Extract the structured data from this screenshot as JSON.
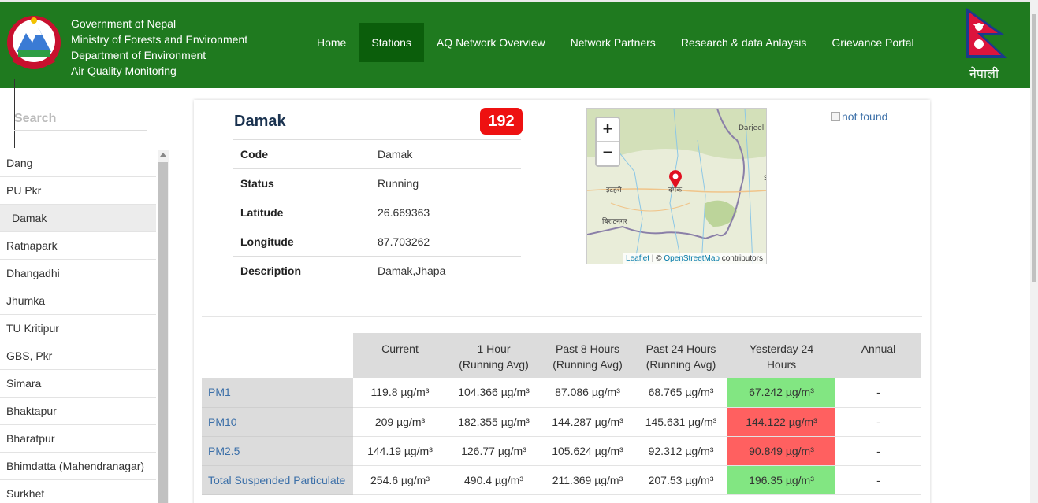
{
  "header": {
    "gov_lines": [
      "Government of Nepal",
      "Ministry of Forests and Environment",
      "Department of Environment",
      "Air Quality Monitoring"
    ],
    "nav": [
      "Home",
      "Stations",
      "AQ Network Overview",
      "Network Partners",
      "Research & data Anlaysis",
      "Grievance Portal"
    ],
    "active_nav": "Stations",
    "language_toggle": "नेपाली",
    "colors": {
      "header_bg": "#1f7a1f",
      "active_nav_bg": "#0b5e0b"
    }
  },
  "sidebar": {
    "search_placeholder": "Search",
    "stations": [
      "Dang",
      "PU Pkr",
      "Damak",
      "Ratnapark",
      "Dhangadhi",
      "Jhumka",
      "TU Kritipur",
      "GBS, Pkr",
      "Simara",
      "Bhaktapur",
      "Bharatpur",
      "Bhimdatta (Mahendranagar)",
      "Surkhet"
    ],
    "selected": "Damak"
  },
  "station": {
    "name": "Damak",
    "aqi": "192",
    "aqi_color": "#ee1111",
    "fields": [
      {
        "label": "Code",
        "value": "Damak"
      },
      {
        "label": "Status",
        "value": "Running"
      },
      {
        "label": "Latitude",
        "value": "26.669363"
      },
      {
        "label": "Longitude",
        "value": "87.703262"
      },
      {
        "label": "Description",
        "value": "Damak,Jhapa"
      }
    ]
  },
  "map": {
    "zoom_in": "+",
    "zoom_out": "−",
    "labels": {
      "darjeeling": "Darjeeli",
      "itahari": "इटहरी",
      "damak": "दमक",
      "biratnagar": "बिराटनगर",
      "s": "S"
    },
    "attribution": {
      "leaflet": "Leaflet",
      "sep": " | © ",
      "osm": "OpenStreetMap",
      "suffix": " contributors"
    }
  },
  "broken_image_alt": "not found",
  "pollutants": {
    "headers": [
      [
        "Current"
      ],
      [
        "1 Hour",
        "(Running Avg)"
      ],
      [
        "Past 8 Hours",
        "(Running Avg)"
      ],
      [
        "Past 24 Hours",
        "(Running Avg)"
      ],
      [
        "Yesterday 24",
        "Hours"
      ],
      [
        "Annual"
      ]
    ],
    "rows": [
      {
        "name": "PM1",
        "current": "119.8 µg/m³",
        "h1": "104.366 µg/m³",
        "h8": "87.086 µg/m³",
        "h24": "68.765 µg/m³",
        "yesterday": "67.242 µg/m³",
        "yesterday_status": "good",
        "annual": "-"
      },
      {
        "name": "PM10",
        "current": "209 µg/m³",
        "h1": "182.355 µg/m³",
        "h8": "144.287 µg/m³",
        "h24": "145.631 µg/m³",
        "yesterday": "144.122 µg/m³",
        "yesterday_status": "bad",
        "annual": "-"
      },
      {
        "name": "PM2.5",
        "current": "144.19 µg/m³",
        "h1": "126.77 µg/m³",
        "h8": "105.624 µg/m³",
        "h24": "92.312 µg/m³",
        "yesterday": "90.849 µg/m³",
        "yesterday_status": "bad",
        "annual": "-"
      },
      {
        "name": "Total Suspended Particulate",
        "current": "254.6 µg/m³",
        "h1": "490.4 µg/m³",
        "h8": "211.369 µg/m³",
        "h24": "207.53 µg/m³",
        "yesterday": "196.35 µg/m³",
        "yesterday_status": "good",
        "annual": "-"
      }
    ],
    "colors": {
      "good": "#82e682",
      "bad": "#ff6060"
    }
  }
}
